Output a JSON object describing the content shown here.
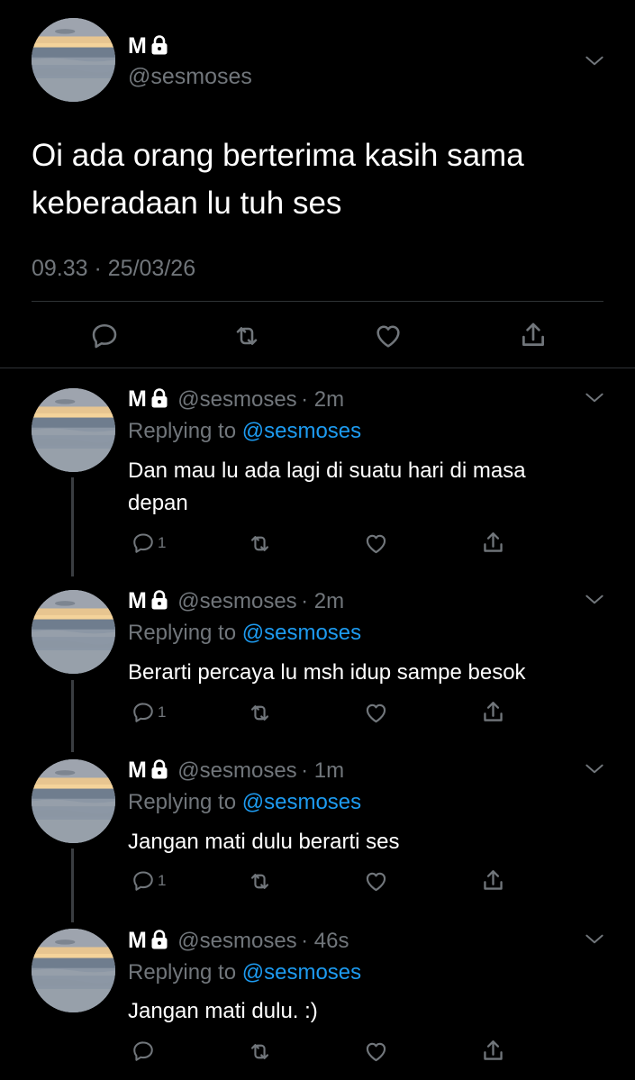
{
  "main_tweet": {
    "name": "M",
    "handle": "@sesmoses",
    "text_line1": "Oi ada orang berterima kasih sama",
    "text_line2": "keberadaan lu tuh ses",
    "timestamp": "09.33 · 25/03/26"
  },
  "replies": [
    {
      "name": "M",
      "handle": "@sesmoses",
      "time": "· 2m",
      "replying_prefix": "Replying to",
      "replying_to": "@sesmoses",
      "text_line1": "Dan mau lu ada lagi di suatu hari di masa",
      "text_line2": "depan",
      "reply_count": "1"
    },
    {
      "name": "M",
      "handle": "@sesmoses",
      "time": "· 2m",
      "replying_prefix": "Replying to",
      "replying_to": "@sesmoses",
      "text_line1": "Berarti percaya lu msh idup sampe besok",
      "text_line2": "",
      "reply_count": "1"
    },
    {
      "name": "M",
      "handle": "@sesmoses",
      "time": "· 1m",
      "replying_prefix": "Replying to",
      "replying_to": "@sesmoses",
      "text_line1": "Jangan mati dulu berarti ses",
      "text_line2": "",
      "reply_count": "1"
    },
    {
      "name": "M",
      "handle": "@sesmoses",
      "time": "· 46s",
      "replying_prefix": "Replying to",
      "replying_to": "@sesmoses",
      "text_line1": "Jangan mati dulu. :)",
      "text_line2": "",
      "reply_count": ""
    }
  ],
  "icons": {
    "reply": "reply-icon",
    "retweet": "retweet-icon",
    "like": "heart-icon",
    "share": "share-icon",
    "more": "chevron-down-icon",
    "protected": "lock-icon"
  },
  "colors": {
    "background": "#000000",
    "link": "#1d9bf0",
    "muted": "#71767b",
    "text": "#e7e9ea"
  }
}
